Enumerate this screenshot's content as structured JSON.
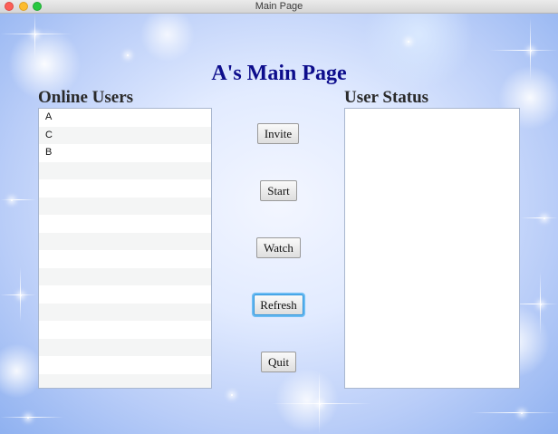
{
  "window": {
    "title": "Main Page"
  },
  "page": {
    "heading": "A's Main Page"
  },
  "online_users": {
    "label": "Online Users",
    "items": [
      "A",
      "C",
      "B",
      "",
      "",
      "",
      "",
      "",
      "",
      "",
      "",
      "",
      "",
      "",
      "",
      ""
    ]
  },
  "user_status": {
    "label": "User Status"
  },
  "buttons": {
    "invite": "Invite",
    "start": "Start",
    "watch": "Watch",
    "refresh": "Refresh",
    "quit": "Quit"
  },
  "colors": {
    "heading": "#0d0d8c",
    "focus_ring": "#6bbcf3",
    "background_blue": "#8fb1f0"
  },
  "state": {
    "focused_button": "refresh"
  }
}
